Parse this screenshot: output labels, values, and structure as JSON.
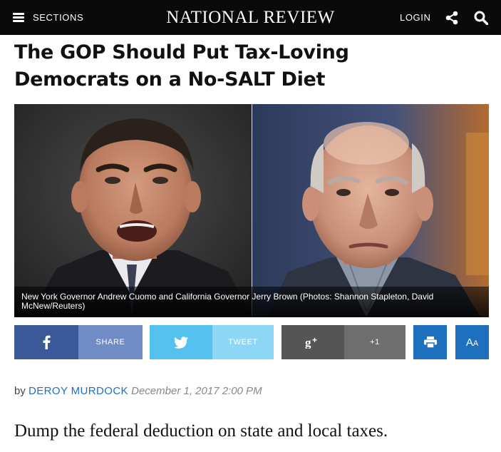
{
  "header": {
    "sections_label": "SECTIONS",
    "brand": "NATIONAL REVIEW",
    "login_label": "LOGIN",
    "icons": [
      "hamburger-icon",
      "share-icon",
      "search-icon"
    ]
  },
  "article": {
    "headline": "The GOP Should Put Tax-Loving Democrats on a No-SALT Diet",
    "image_caption": "New York Governor Andrew Cuomo and California Governor Jerry Brown (Photos: Shannon Stapleton, David McNew/Reuters)",
    "byline_prefix": "by",
    "author": "DEROY MURDOCK",
    "date": "December 1, 2017 2:00 PM",
    "dek": "Dump the federal deduction on state and local taxes."
  },
  "share": {
    "facebook_label": "SHARE",
    "twitter_label": "TWEET",
    "googleplus_label": "+1",
    "font_size_label": "AA"
  },
  "colors": {
    "topbar": "#0a0a0a",
    "facebook": "#3b5998",
    "facebook_light": "#6f8dc4",
    "twitter": "#55c1ee",
    "twitter_light": "#8cd7f5",
    "googleplus": "#555555",
    "googleplus_light": "#6e6e6e",
    "accent_blue": "#1f6fbf"
  }
}
